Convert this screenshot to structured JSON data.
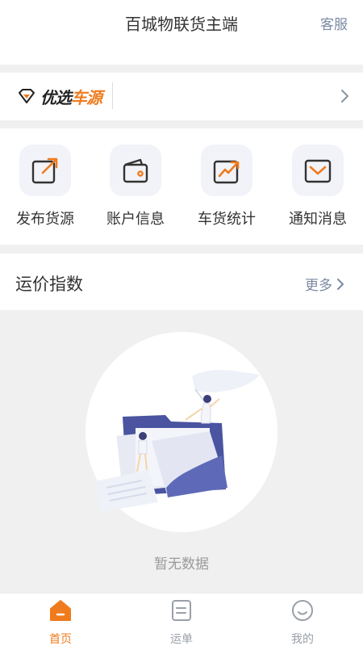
{
  "header": {
    "title": "百城物联货主端",
    "service": "客服"
  },
  "banner": {
    "brand_part1": "优选",
    "brand_part2": "车源"
  },
  "quick": [
    {
      "label": "发布货源",
      "icon": "publish-icon"
    },
    {
      "label": "账户信息",
      "icon": "wallet-icon"
    },
    {
      "label": "车货统计",
      "icon": "stats-icon"
    },
    {
      "label": "通知消息",
      "icon": "mail-icon"
    }
  ],
  "section": {
    "title": "运价指数",
    "more": "更多"
  },
  "empty": {
    "text": "暂无数据"
  },
  "tabs": [
    {
      "label": "首页",
      "icon": "home-icon",
      "active": true
    },
    {
      "label": "运单",
      "icon": "waybill-icon",
      "active": false
    },
    {
      "label": "我的",
      "icon": "profile-icon",
      "active": false
    }
  ],
  "colors": {
    "accent": "#f07b1d",
    "muted": "#7b8aa3",
    "icon_bg": "#f2f3f8"
  }
}
